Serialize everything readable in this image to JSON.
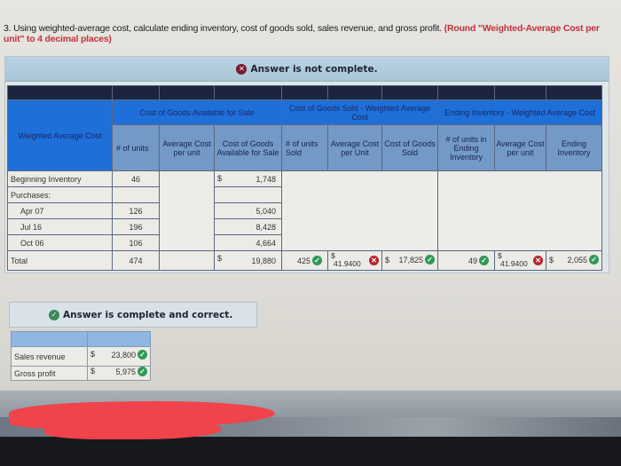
{
  "question": {
    "text": "3. Using weighted-average cost, calculate ending inventory, cost of goods sold, sales revenue, and gross profit.",
    "hint": "(Round \"Weighted-Average Cost per unit\" to 4 decimal places)"
  },
  "panel1": {
    "status": "Answer is not complete.",
    "status_icon": "x-icon",
    "table": {
      "row_header": "Weighted Average Cost",
      "groups": {
        "available": "Cost of Goods Available for Sale",
        "cogs": "Cost of Goods Sold - Weighted Average Cost",
        "ending": "Ending Inventory - Weighted Average Cost"
      },
      "columns": {
        "avail_units": "# of units",
        "avail_avg": "Average Cost per unit",
        "avail_cost": "Cost of Goods Available for Sale",
        "sold_units": "# of units Sold",
        "sold_avg": "Average Cost per Unit",
        "sold_cost": "Cost of Goods Sold",
        "end_units": "# of units in Ending Inventory",
        "end_avg": "Average Cost per unit",
        "end_inv": "Ending Inventory"
      },
      "rows": [
        {
          "label": "Beginning Inventory",
          "units": "46",
          "currency": "$",
          "cost": "1,748"
        },
        {
          "label": "Purchases:",
          "units": "",
          "currency": "",
          "cost": ""
        },
        {
          "label": "Apr 07",
          "units": "126",
          "currency": "",
          "cost": "5,040"
        },
        {
          "label": "Jul 16",
          "units": "196",
          "currency": "",
          "cost": "8,428"
        },
        {
          "label": "Oct 06",
          "units": "106",
          "currency": "",
          "cost": "4,664"
        }
      ],
      "total": {
        "label": "Total",
        "units": "474",
        "currency": "$",
        "cost": "19,880",
        "sold_units": "425",
        "sold_units_status": "correct",
        "sold_avg_currency": "$",
        "sold_avg": "41.9400",
        "sold_avg_status": "incorrect",
        "sold_cost_currency": "$",
        "sold_cost": "17,825",
        "sold_cost_status": "correct",
        "end_units": "49",
        "end_units_status": "correct",
        "end_avg_currency": "$",
        "end_avg": "41.9400",
        "end_avg_status": "incorrect",
        "end_inv_currency": "$",
        "end_inv": "2,055",
        "end_inv_status": "correct"
      }
    }
  },
  "panel2": {
    "status": "Answer is complete and correct.",
    "status_icon": "check-icon",
    "rows": [
      {
        "label": "Sales revenue",
        "currency": "$",
        "value": "23,800",
        "status": "correct"
      },
      {
        "label": "Gross profit",
        "currency": "$",
        "value": "5,975",
        "status": "correct"
      }
    ]
  },
  "icons": {
    "check": "✓",
    "x": "✕"
  },
  "colors": {
    "correct": "#2f9a56",
    "incorrect": "#b3262f",
    "hint_red": "#c4323c",
    "group_header_blue": "#1f6fd8",
    "subheader_blue": "#7399c6"
  }
}
